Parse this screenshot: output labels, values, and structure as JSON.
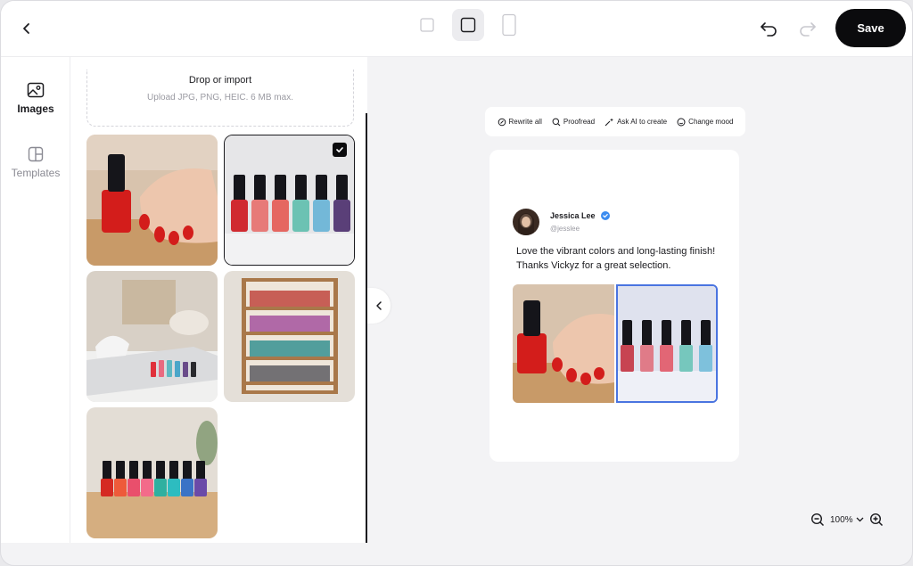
{
  "header": {
    "save_label": "Save"
  },
  "rail": {
    "items": [
      {
        "label": "Images",
        "icon": "image-icon"
      },
      {
        "label": "Templates",
        "icon": "template-icon"
      }
    ]
  },
  "panel": {
    "dropzone_title": "Drop or import",
    "dropzone_subtitle": "Upload JPG, PNG, HEIC. 6 MB max."
  },
  "ai_toolbar": {
    "rewrite": "Rewrite all",
    "proofread": "Proofread",
    "ask_ai": "Ask AI to create",
    "change_mood": "Change mood"
  },
  "post": {
    "author_name": "Jessica Lee",
    "handle": "@jesslee",
    "text": "Love the vibrant colors and long-lasting finish! Thanks Vickyz for a great selection."
  },
  "zoom": {
    "value": "100%"
  },
  "colors": {
    "accent": "#4a74e0",
    "primary_button": "#0b0b0d",
    "verified": "#3b8cf0"
  }
}
